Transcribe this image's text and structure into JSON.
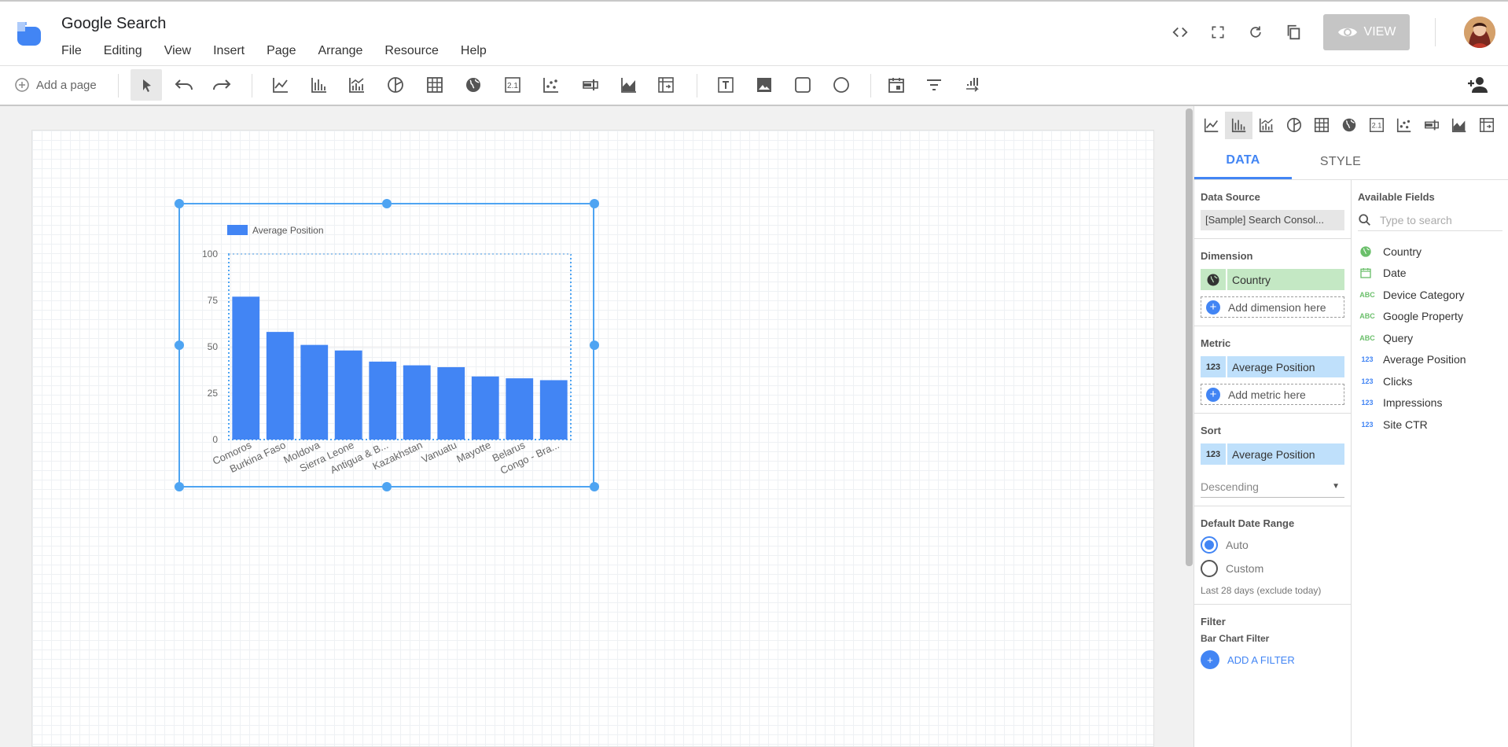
{
  "app": {
    "title": "Google Search",
    "view_label": "VIEW"
  },
  "menu": [
    "File",
    "Editing",
    "View",
    "Insert",
    "Page",
    "Arrange",
    "Resource",
    "Help"
  ],
  "toolbar": {
    "add_page": "Add a page"
  },
  "panel": {
    "tabs": {
      "data": "DATA",
      "style": "STYLE"
    },
    "data_source": {
      "label": "Data Source",
      "value": "[Sample] Search Consol..."
    },
    "dimension": {
      "label": "Dimension",
      "value": "Country",
      "add": "Add dimension here"
    },
    "metric": {
      "label": "Metric",
      "value": "Average Position",
      "add": "Add metric here"
    },
    "sort": {
      "label": "Sort",
      "value": "Average Position",
      "order": "Descending"
    },
    "date_range": {
      "label": "Default Date Range",
      "auto": "Auto",
      "custom": "Custom",
      "note": "Last 28 days (exclude today)"
    },
    "filter": {
      "label": "Filter",
      "sub": "Bar Chart Filter",
      "add": "ADD A FILTER"
    },
    "fields": {
      "label": "Available Fields",
      "search_placeholder": "Type to search",
      "items": [
        {
          "name": "Country",
          "type": "geo"
        },
        {
          "name": "Date",
          "type": "date"
        },
        {
          "name": "Device Category",
          "type": "ABC"
        },
        {
          "name": "Google Property",
          "type": "ABC"
        },
        {
          "name": "Query",
          "type": "ABC"
        },
        {
          "name": "Average Position",
          "type": "123"
        },
        {
          "name": "Clicks",
          "type": "123"
        },
        {
          "name": "Impressions",
          "type": "123"
        },
        {
          "name": "Site CTR",
          "type": "123"
        }
      ]
    }
  },
  "chart_data": {
    "type": "bar",
    "categories": [
      "Comoros",
      "Burkina Faso",
      "Moldova",
      "Sierra Leone",
      "Antigua & B...",
      "Kazakhstan",
      "Vanuatu",
      "Mayotte",
      "Belarus",
      "Congo - Bra..."
    ],
    "series": [
      {
        "name": "Average Position",
        "values": [
          77,
          58,
          51,
          48,
          42,
          40,
          39,
          34,
          33,
          32
        ]
      }
    ],
    "yticks": [
      0,
      25,
      50,
      75,
      100
    ],
    "ylim": [
      0,
      100
    ],
    "color": "#4285f4",
    "legend": "top-left"
  }
}
